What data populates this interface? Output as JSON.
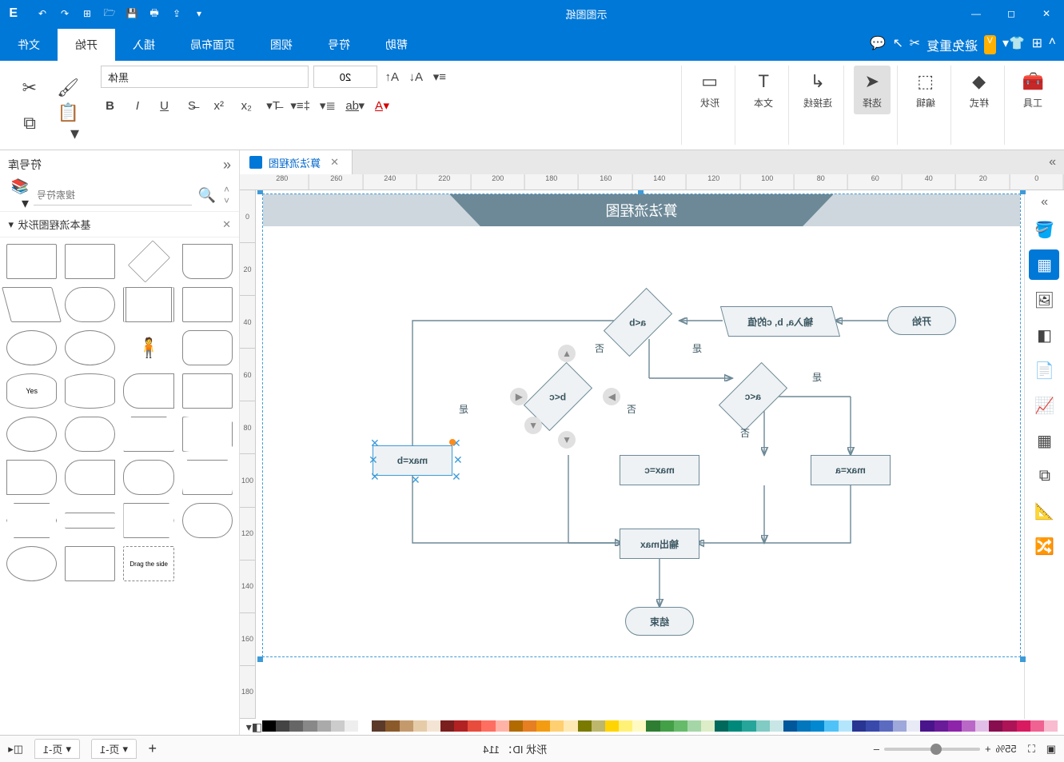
{
  "title": "示图图纸",
  "qat_icons": [
    "undo",
    "redo",
    "save",
    "open",
    "print",
    "cloud",
    "dropdown"
  ],
  "menu_tabs": [
    "文件",
    "开始",
    "插入",
    "页面布局",
    "视图",
    "符号",
    "帮助"
  ],
  "active_tab": 1,
  "right_menu_tools": [
    "speech",
    "pointer",
    "scissors",
    "compare",
    "避免重复"
  ],
  "ribbon": {
    "cut": "剪切",
    "copy": "复制",
    "paste": "粘贴",
    "format_painter": "格式刷",
    "font_name": "黑体",
    "font_size": "20",
    "font_buttons": [
      "B",
      "I",
      "U",
      "S",
      "x²",
      "x₂",
      "T",
      "Aa",
      "≡",
      "⇅",
      "abc",
      "A"
    ],
    "align_buttons": [
      "A+",
      "A-",
      "≡"
    ],
    "groups": {
      "shape": "形状",
      "text": "文本",
      "connector": "连接线",
      "select": "选择",
      "edit": "编辑",
      "style": "样式",
      "tools": "工具"
    }
  },
  "left_panel": {
    "title": "符号库",
    "search_placeholder": "搜索符号",
    "category": "基本流程图形状"
  },
  "doc_tab": "算法流程图",
  "ruler_h": [
    "0",
    "20",
    "40",
    "60",
    "80",
    "100",
    "120",
    "140",
    "160",
    "180",
    "200",
    "220",
    "240",
    "260",
    "280"
  ],
  "ruler_v": [
    "0",
    "20",
    "40",
    "60",
    "80",
    "100",
    "120",
    "140",
    "160",
    "180"
  ],
  "flowchart": {
    "banner": "算法流程图",
    "start": "开始",
    "input": "输入a, b, c的值",
    "d1": "a<b",
    "d2": "a<c",
    "d3": "b<c",
    "maxa": "max=a",
    "maxc": "max=c",
    "maxb": "max=b",
    "out": "输出max",
    "end": "结束",
    "yes": "是",
    "no": "否"
  },
  "rightbar_icons": [
    "fill",
    "layers",
    "image",
    "chart",
    "grid",
    "layout",
    "ruler",
    "sitemap"
  ],
  "colors": [
    "#000",
    "#444",
    "#666",
    "#888",
    "#aaa",
    "#ccc",
    "#eee",
    "#fff",
    "#5b3a29",
    "#8b5a2b",
    "#c49a6c",
    "#e6cba8",
    "#f4e4d4",
    "#7b1e1e",
    "#b22222",
    "#e74c3c",
    "#ff6f61",
    "#ffb3a7",
    "#b26b00",
    "#e67e22",
    "#f39c12",
    "#ffcf70",
    "#ffe9b3",
    "#7a7a00",
    "#bdb76b",
    "#ffd400",
    "#fff176",
    "#fffac2",
    "#2e7d32",
    "#43a047",
    "#66bb6a",
    "#a5d6a7",
    "#dcedc8",
    "#00695c",
    "#00897b",
    "#26a69a",
    "#80cbc4",
    "#c8e6e5",
    "#01579b",
    "#0277bd",
    "#0288d1",
    "#4fc3f7",
    "#b3e5fc",
    "#283593",
    "#3949ab",
    "#5c6bc0",
    "#9fa8da",
    "#e8eaf6",
    "#4a148c",
    "#6a1b9a",
    "#8e24aa",
    "#ba68c8",
    "#e1bee7",
    "#880e4f",
    "#ad1457",
    "#d81b60",
    "#f06292",
    "#f8bbd0"
  ],
  "status": {
    "page_tab": "页-1",
    "shape_id": "形状 ID： 114",
    "zoom": "55%",
    "plus": "+",
    "minus": "–"
  }
}
